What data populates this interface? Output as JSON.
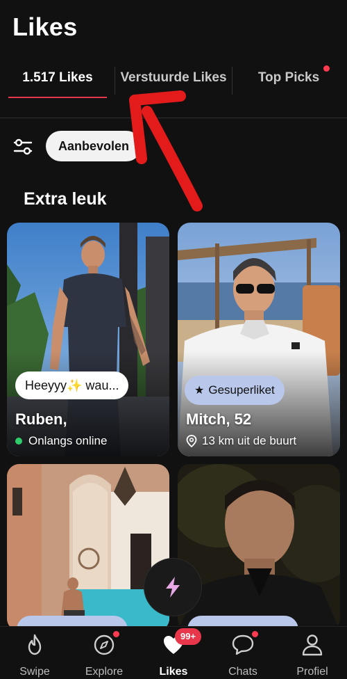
{
  "header": {
    "title": "Likes"
  },
  "tabs": [
    {
      "label": "1.517 Likes",
      "active": true
    },
    {
      "label": "Verstuurde Likes",
      "active": false
    },
    {
      "label": "Top Picks",
      "active": false,
      "has_dot": true
    }
  ],
  "filter": {
    "icon": "sliders-icon",
    "chip_label": "Aanbevolen"
  },
  "section": {
    "title": "Extra leuk"
  },
  "cards": [
    {
      "name": "Ruben,",
      "status": "Onlangs online",
      "message": "Heeyyy✨ wau..."
    },
    {
      "name": "Mitch, 52",
      "distance": "13 km uit de buurt",
      "badge": "Gesuperliket"
    }
  ],
  "nav": {
    "items": [
      {
        "label": "Swipe",
        "icon": "flame-icon",
        "active": false
      },
      {
        "label": "Explore",
        "icon": "compass-icon",
        "active": false,
        "has_dot": true
      },
      {
        "label": "Likes",
        "icon": "heart-icon",
        "active": true,
        "badge": "99+"
      },
      {
        "label": "Chats",
        "icon": "chat-icon",
        "active": false,
        "has_dot": true
      },
      {
        "label": "Profiel",
        "icon": "person-icon",
        "active": false
      }
    ]
  },
  "colors": {
    "accent": "#e8364a",
    "background": "#111111",
    "superlike_badge": "#b9c8ea",
    "online": "#2fcc6b"
  }
}
